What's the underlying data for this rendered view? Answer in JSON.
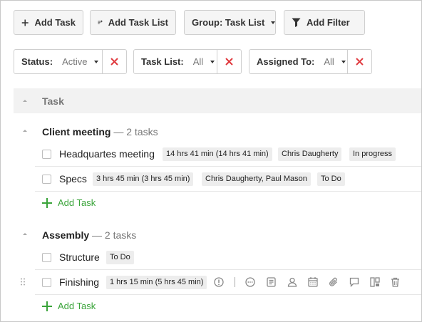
{
  "toolbar": {
    "add_task": "Add Task",
    "add_task_list": "Add Task List",
    "group": "Group: Task List",
    "add_filter": "Add Filter"
  },
  "filters": [
    {
      "label": "Status:",
      "value": "Active"
    },
    {
      "label": "Task List:",
      "value": "All"
    },
    {
      "label": "Assigned To:",
      "value": "All"
    }
  ],
  "table": {
    "header": "Task"
  },
  "groups": [
    {
      "name": "Client meeting",
      "count": "— 2 tasks",
      "tasks": [
        {
          "name": "Headquartes meeting",
          "time": "14 hrs 41 min (14 hrs 41 min)",
          "assignee": "Chris Daugherty",
          "status": "In progress"
        },
        {
          "name": "Specs",
          "time": "3 hrs 45 min (3 hrs 45 min)",
          "assignee": "Chris Daugherty, Paul Mason",
          "status": "To Do"
        }
      ],
      "add_label": "Add Task"
    },
    {
      "name": "Assembly",
      "count": "— 2 tasks",
      "tasks": [
        {
          "name": "Structure",
          "status": "To Do"
        },
        {
          "name": "Finishing",
          "time": "1 hrs 15 min (5 hrs 45 min)"
        }
      ],
      "add_label": "Add Task"
    }
  ],
  "colors": {
    "accent_green": "#3aa43a",
    "remove_red": "#e0393e"
  },
  "row_actions": [
    "priority-icon",
    "more-icon",
    "notes-icon",
    "assignee-icon",
    "calendar-icon",
    "attachment-icon",
    "comment-icon",
    "board-icon",
    "trash-icon"
  ]
}
